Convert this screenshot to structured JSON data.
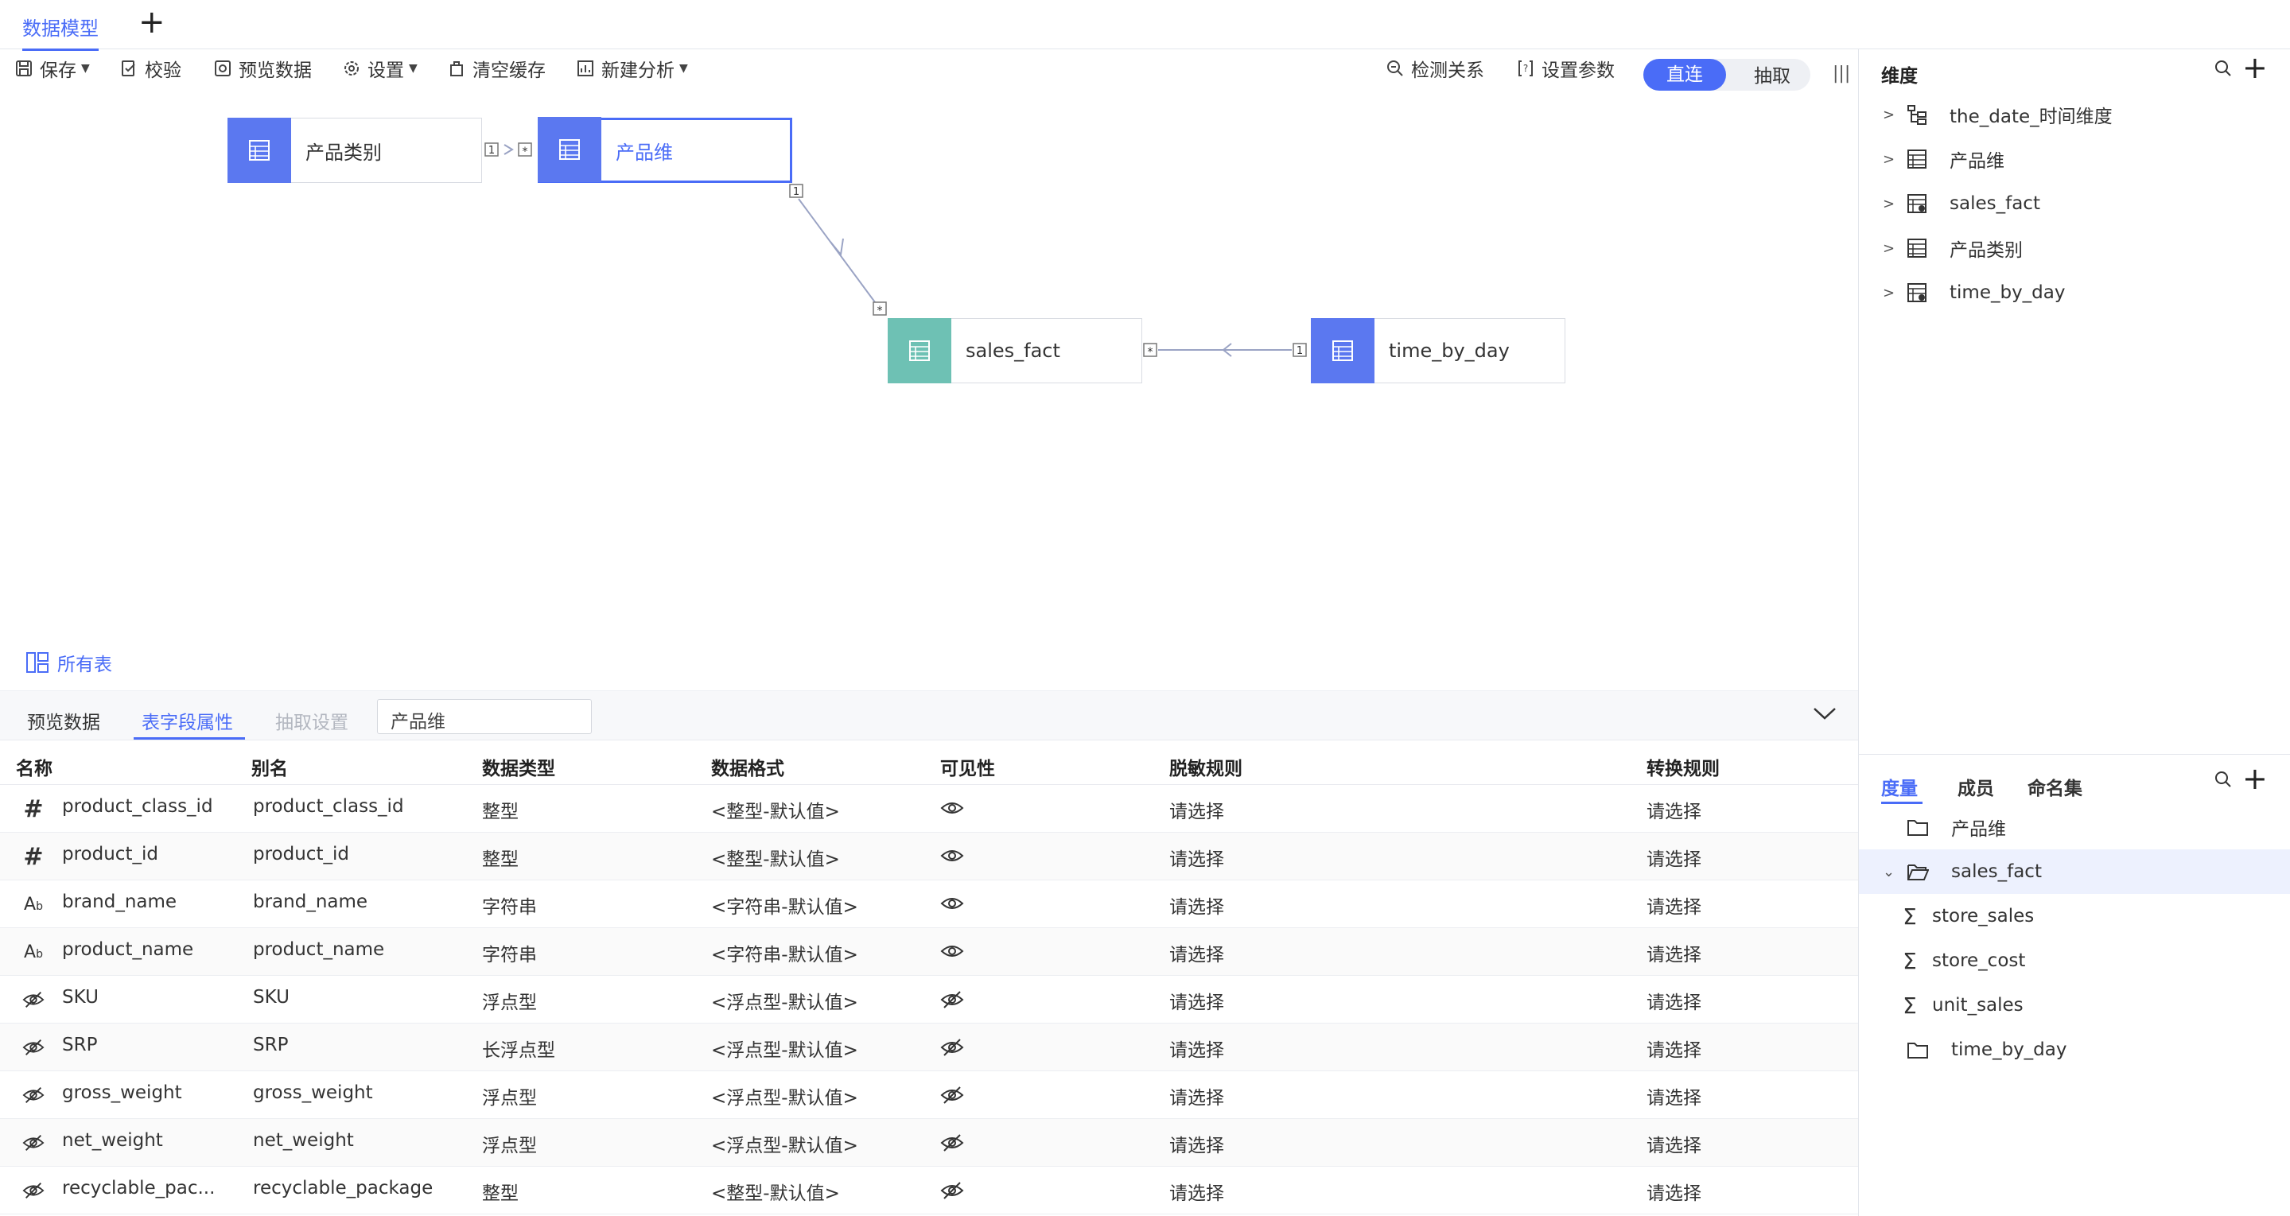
{
  "tabs": {
    "active": "数据模型",
    "add": "+"
  },
  "toolbar": {
    "save": "保存",
    "validate": "校验",
    "preview": "预览数据",
    "settings": "设置",
    "clear_cache": "清空缓存",
    "new_analysis": "新建分析",
    "detect_relations": "检测关系",
    "set_params": "设置参数",
    "mode_direct": "直连",
    "mode_extract": "抽取"
  },
  "canvas": {
    "nodes": {
      "product_class": "产品类别",
      "product_dim": "产品维",
      "sales_fact": "sales_fact",
      "time_by_day": "time_by_day"
    },
    "link_labels": {
      "one": "1",
      "many": "*"
    },
    "all_tables": "所有表"
  },
  "bottom": {
    "tabs": {
      "preview": "预览数据",
      "field_props": "表字段属性",
      "extract_settings": "抽取设置"
    },
    "table_select": "产品维",
    "columns": [
      "名称",
      "别名",
      "数据类型",
      "数据格式",
      "可见性",
      "脱敏规则",
      "转换规则"
    ],
    "rows": [
      {
        "type_icon": "hash-icon",
        "name": "product_class_id",
        "alias": "product_class_id",
        "dtype": "整型",
        "format": "<整型-默认值>",
        "visible": true,
        "mask": "请选择",
        "transform": "请选择"
      },
      {
        "type_icon": "hash-icon",
        "name": "product_id",
        "alias": "product_id",
        "dtype": "整型",
        "format": "<整型-默认值>",
        "visible": true,
        "mask": "请选择",
        "transform": "请选择"
      },
      {
        "type_icon": "text-icon",
        "name": "brand_name",
        "alias": "brand_name",
        "dtype": "字符串",
        "format": "<字符串-默认值>",
        "visible": true,
        "mask": "请选择",
        "transform": "请选择"
      },
      {
        "type_icon": "text-icon",
        "name": "product_name",
        "alias": "product_name",
        "dtype": "字符串",
        "format": "<字符串-默认值>",
        "visible": true,
        "mask": "请选择",
        "transform": "请选择"
      },
      {
        "type_icon": "hidden-icon",
        "name": "SKU",
        "alias": "SKU",
        "dtype": "浮点型",
        "format": "<浮点型-默认值>",
        "visible": false,
        "mask": "请选择",
        "transform": "请选择"
      },
      {
        "type_icon": "hidden-icon",
        "name": "SRP",
        "alias": "SRP",
        "dtype": "长浮点型",
        "format": "<浮点型-默认值>",
        "visible": false,
        "mask": "请选择",
        "transform": "请选择"
      },
      {
        "type_icon": "hidden-icon",
        "name": "gross_weight",
        "alias": "gross_weight",
        "dtype": "浮点型",
        "format": "<浮点型-默认值>",
        "visible": false,
        "mask": "请选择",
        "transform": "请选择"
      },
      {
        "type_icon": "hidden-icon",
        "name": "net_weight",
        "alias": "net_weight",
        "dtype": "浮点型",
        "format": "<浮点型-默认值>",
        "visible": false,
        "mask": "请选择",
        "transform": "请选择"
      },
      {
        "type_icon": "hidden-icon",
        "name": "recyclable_pac...",
        "alias": "recyclable_package",
        "dtype": "整型",
        "format": "<整型-默认值>",
        "visible": false,
        "mask": "请选择",
        "transform": "请选择"
      }
    ]
  },
  "dimensions": {
    "title": "维度",
    "items": [
      "the_date_时间维度",
      "产品维",
      "sales_fact",
      "产品类别",
      "time_by_day"
    ]
  },
  "measures": {
    "tabs": [
      "度量",
      "成员",
      "命名集"
    ],
    "folders": [
      {
        "label": "产品维",
        "expanded": false
      },
      {
        "label": "sales_fact",
        "expanded": true,
        "children": [
          "store_sales",
          "store_cost",
          "unit_sales"
        ]
      },
      {
        "label": "time_by_day",
        "expanded": false
      }
    ]
  },
  "colors": {
    "accent": "#4a6cf7",
    "fact_node": "#6ec1b4",
    "link": "#9aa3c4"
  }
}
